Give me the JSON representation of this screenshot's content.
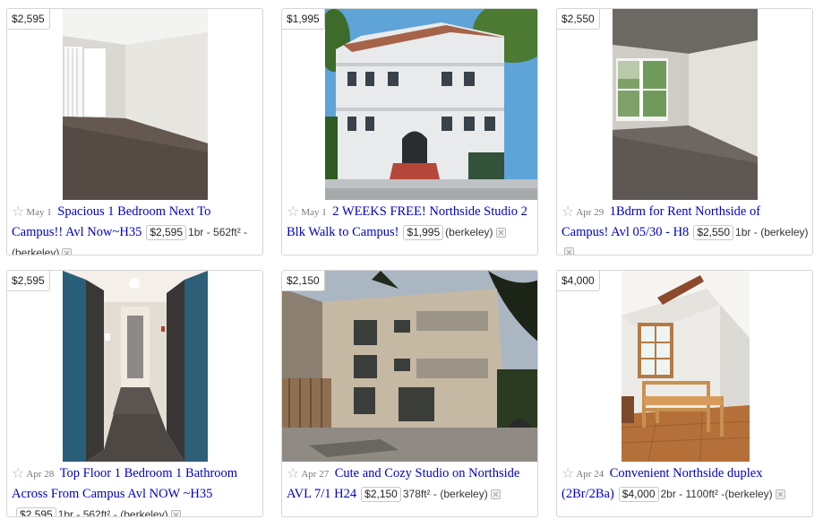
{
  "listings": [
    {
      "badge_price": "$2,595",
      "date": "May 1",
      "title": "Spacious 1 Bedroom Next To Campus!! Avl Now~H35",
      "price": "$2,595",
      "meta": "1br - 562ft² -",
      "hood": "(berkeley)",
      "image": "empty-room-with-window-photo"
    },
    {
      "badge_price": "$1,995",
      "date": "May 1",
      "title": "2 WEEKS FREE! Northside Studio 2 Blk Walk to Campus!",
      "price": "$1,995",
      "meta": "",
      "hood": "(berkeley)",
      "image": "white-apartment-building-photo"
    },
    {
      "badge_price": "$2,550",
      "date": "Apr 29",
      "title": "1Bdrm for Rent Northside of Campus! Avl 05/30 - H8",
      "price": "$2,550",
      "meta": "1br -",
      "hood": "(berkeley)",
      "image": "empty-room-corner-window-photo"
    },
    {
      "badge_price": "$2,595",
      "date": "Apr 28",
      "title": "Top Floor 1 Bedroom 1 Bathroom Across From Campus Avl NOW ~H35",
      "price": "$2,595",
      "meta": "1br - 562ft² -",
      "hood": "(berkeley)",
      "image": "hallway-doors-photo"
    },
    {
      "badge_price": "$2,150",
      "date": "Apr 27",
      "title": "Cute and Cozy Studio on Northside AVL 7/1 H24",
      "price": "$2,150",
      "meta": "378ft² -",
      "hood": "(berkeley)",
      "image": "beige-apartment-courtyard-photo"
    },
    {
      "badge_price": "$4,000",
      "date": "Apr 24",
      "title": "Convenient Northside duplex (2Br/2Ba)",
      "price": "$4,000",
      "meta": "2br - 1100ft² -",
      "hood": "(berkeley)",
      "image": "attic-bedroom-bedframe-photo"
    }
  ]
}
